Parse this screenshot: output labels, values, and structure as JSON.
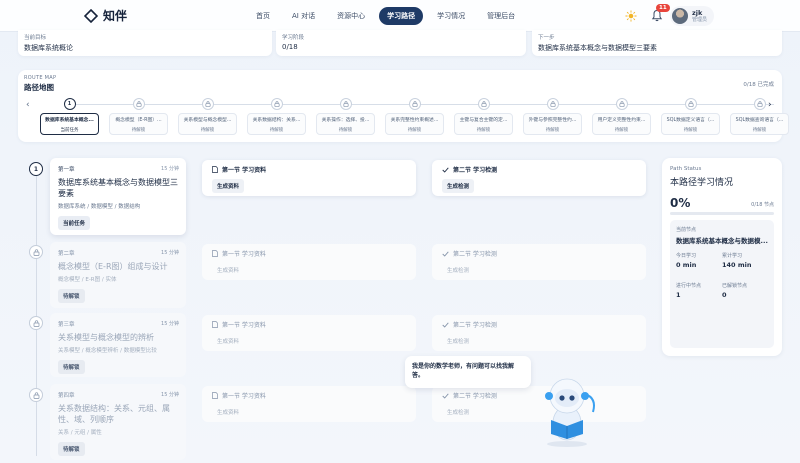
{
  "brand": {
    "name": "知伴"
  },
  "nav": {
    "items": [
      {
        "label": "首页"
      },
      {
        "label": "AI 对话"
      },
      {
        "label": "资源中心"
      },
      {
        "label": "学习路径"
      },
      {
        "label": "学习情况"
      },
      {
        "label": "管理后台"
      }
    ],
    "active_index": 3
  },
  "header": {
    "notification_count": "11",
    "user": {
      "name": "zjk",
      "role": "管理员"
    }
  },
  "info": {
    "goal": {
      "label": "当前目标",
      "value": "数据库系统概论"
    },
    "stage": {
      "label": "学习阶段",
      "value": "0/18"
    },
    "next": {
      "label": "下一步",
      "value": "数据库系统基本概念与数据模型三要素"
    }
  },
  "route_map": {
    "tag": "ROUTE MAP",
    "title": "路径地图",
    "unlocked": "0/18 已完成",
    "nodes": [
      {
        "title": "数据库系统基本概念...",
        "status": "当前任务",
        "marker": "1",
        "active": true
      },
      {
        "title": "概念模型（E-R图）...",
        "status": "待解锁"
      },
      {
        "title": "关系模型与概念模型...",
        "status": "待解锁"
      },
      {
        "title": "关系数据结构：关系...",
        "status": "待解锁"
      },
      {
        "title": "关系操作：选择、投...",
        "status": "待解锁"
      },
      {
        "title": "关系完整性约束概述...",
        "status": "待解锁"
      },
      {
        "title": "主键与复合主键的定...",
        "status": "待解锁"
      },
      {
        "title": "外键与参照完整性约...",
        "status": "待解锁"
      },
      {
        "title": "用户定义完整性约束...",
        "status": "待解锁"
      },
      {
        "title": "SQL数据定义语言（...",
        "status": "待解锁"
      },
      {
        "title": "SQL数据查询语言（...",
        "status": "待解锁"
      }
    ]
  },
  "chapters": [
    {
      "num": "第一章",
      "time": "15 分钟",
      "marker": "1",
      "title": "数据库系统基本概念与数据模型三要素",
      "tags": "数据库系统 / 数据模型 / 数据结构",
      "button": "当前任务",
      "sec1": {
        "title": "第一节 学习资料",
        "button": "生成资料"
      },
      "sec2": {
        "title": "第二节 学习检测",
        "button": "生成检测"
      }
    },
    {
      "num": "第二章",
      "time": "15 分钟",
      "title": "概念模型（E-R图）组成与设计",
      "tags": "概念模型 / E-R图 / 实体",
      "button": "待解锁",
      "sec1": {
        "title": "第一节 学习资料",
        "button": "生成资料"
      },
      "sec2": {
        "title": "第二节 学习检测",
        "button": "生成检测"
      }
    },
    {
      "num": "第三章",
      "time": "15 分钟",
      "title": "关系模型与概念模型的辨析",
      "tags": "关系模型 / 概念模型辨析 / 数据模型比较",
      "button": "待解锁",
      "sec1": {
        "title": "第一节 学习资料",
        "button": "生成资料"
      },
      "sec2": {
        "title": "第二节 学习检测",
        "button": "生成检测"
      }
    },
    {
      "num": "第四章",
      "time": "15 分钟",
      "title": "关系数据结构：关系、元组、属性、域、列顺序",
      "tags": "关系 / 元组 / 属性",
      "button": "待解锁",
      "sec1": {
        "title": "第一节 学习资料",
        "button": "生成资料"
      },
      "sec2": {
        "title": "第二节 学习检测",
        "button": "生成检测"
      }
    }
  ],
  "status_panel": {
    "tag": "Path Status",
    "title": "本路径学习情况",
    "percent": "0%",
    "nodes": "0/18 节点",
    "progress_fraction": 0,
    "current_label": "当前节点",
    "current_value": "数据库系统基本概念与数据模...",
    "today_label": "今日学习",
    "today_value": "0 min",
    "total_label": "累计学习",
    "total_value": "140 min",
    "inprogress_label": "进行中节点",
    "inprogress_value": "1",
    "unlocked_label": "已解锁节点",
    "unlocked_value": "0"
  },
  "assistant": {
    "message": "我是你的数学老师，有问题可以找我解答。"
  }
}
